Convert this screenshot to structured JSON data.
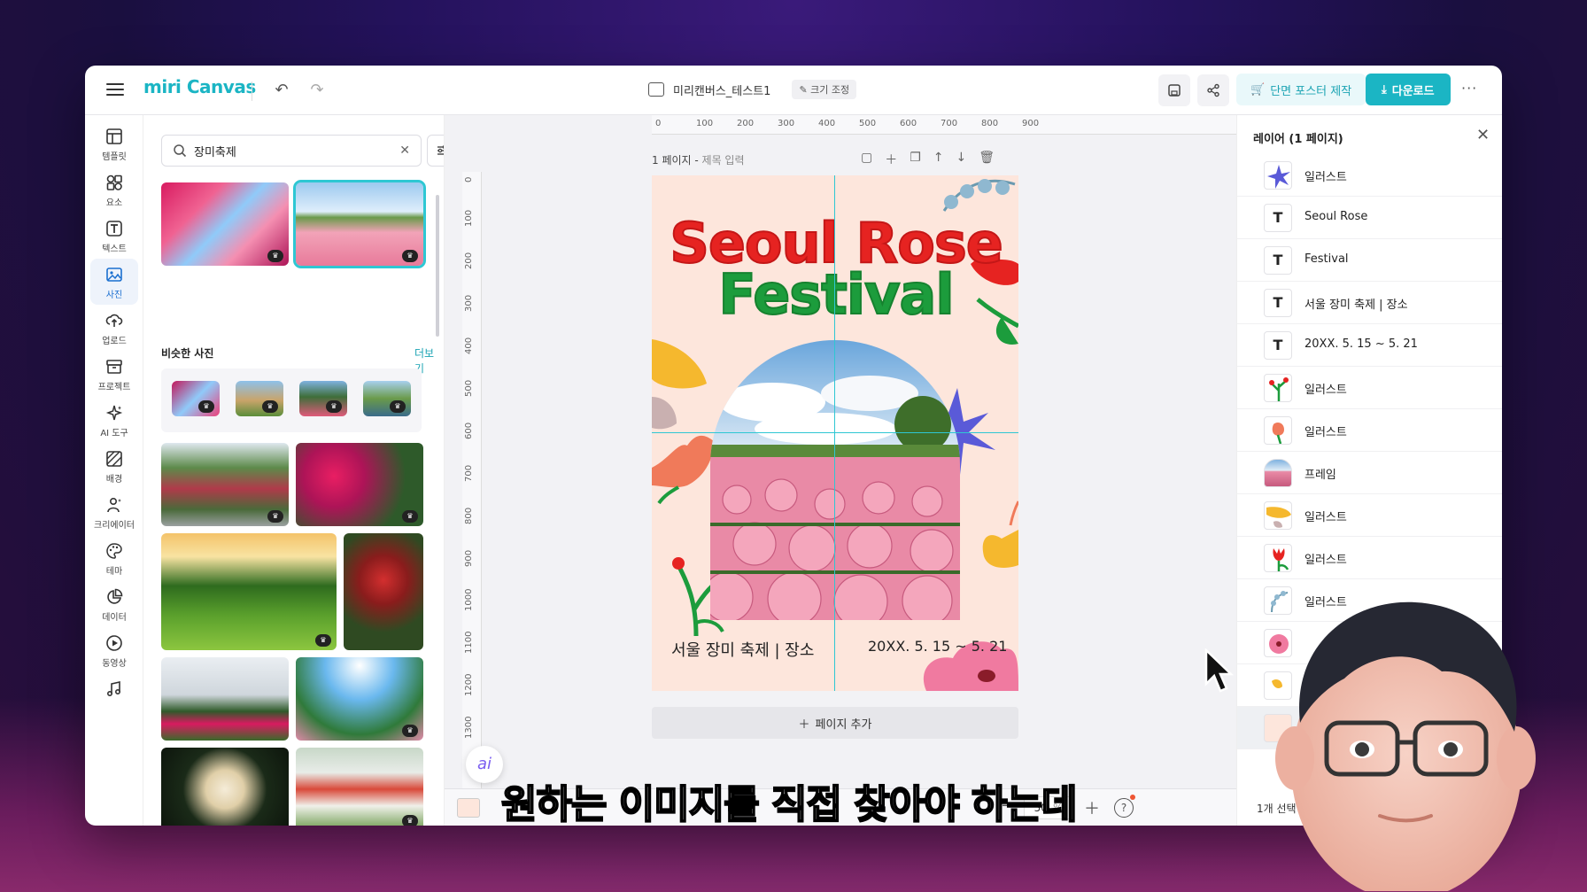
{
  "app": {
    "logo": "miri Canvas",
    "doc_title": "미리캔버스_테스트1",
    "resize_label": "크기 조정",
    "poster_label": "단면 포스터 제작",
    "download_label": "다운로드",
    "more": "···"
  },
  "rail": [
    {
      "label": "템플릿",
      "icon": "template-icon"
    },
    {
      "label": "요소",
      "icon": "elements-icon"
    },
    {
      "label": "텍스트",
      "icon": "text-icon"
    },
    {
      "label": "사진",
      "icon": "photo-icon",
      "active": true
    },
    {
      "label": "업로드",
      "icon": "upload-icon"
    },
    {
      "label": "프로젝트",
      "icon": "project-icon"
    },
    {
      "label": "AI 도구",
      "icon": "ai-tools-icon"
    },
    {
      "label": "배경",
      "icon": "background-icon"
    },
    {
      "label": "크리에이터",
      "icon": "creator-icon"
    },
    {
      "label": "테마",
      "icon": "theme-icon"
    },
    {
      "label": "데이터",
      "icon": "data-icon"
    },
    {
      "label": "동영상",
      "icon": "video-icon"
    }
  ],
  "panel": {
    "search_value": "장미축제",
    "similar_title": "비슷한 사진",
    "more_link": "더보기"
  },
  "canvas": {
    "page_label": "1 페이지 - ",
    "page_title_placeholder": "제목 입력",
    "ruler_top": [
      "0",
      "100",
      "200",
      "300",
      "400",
      "500",
      "600",
      "700",
      "800",
      "900"
    ],
    "ruler_left": [
      "0",
      "100",
      "200",
      "300",
      "400",
      "500",
      "600",
      "700",
      "800",
      "900",
      "1000",
      "1100",
      "1200",
      "1300"
    ],
    "add_page": "페이지 추가",
    "zoom": "50",
    "zoom_unit": "%",
    "ai_label": "ai"
  },
  "poster": {
    "title_line1": "Seoul Rose",
    "title_line2": "Festival",
    "place": "서울 장미 축제 | 장소",
    "date": "20XX. 5. 15 ~ 5. 21",
    "bg_color": "#fde6dc"
  },
  "layers": {
    "header": "레이어 (1 페이지)",
    "items": [
      {
        "name": "일러스트",
        "type": "illust"
      },
      {
        "name": "Seoul Rose",
        "type": "text"
      },
      {
        "name": "Festival",
        "type": "text"
      },
      {
        "name": "서울 장미 축제 | 장소",
        "type": "text"
      },
      {
        "name": "20XX. 5. 15 ~ 5. 21",
        "type": "text"
      },
      {
        "name": "일러스트",
        "type": "illust"
      },
      {
        "name": "일러스트",
        "type": "illust"
      },
      {
        "name": "프레임",
        "type": "frame"
      },
      {
        "name": "일러스트",
        "type": "illust"
      },
      {
        "name": "일러스트",
        "type": "illust"
      },
      {
        "name": "일러스트",
        "type": "illust"
      }
    ],
    "footer": "1개 선택"
  },
  "overlay": {
    "subtitle": "원하는 이미지를 직접 찾아야 하는데"
  },
  "colors": {
    "accent": "#1bb5c4",
    "title_red": "#e62321",
    "title_green": "#1c9c3c"
  }
}
